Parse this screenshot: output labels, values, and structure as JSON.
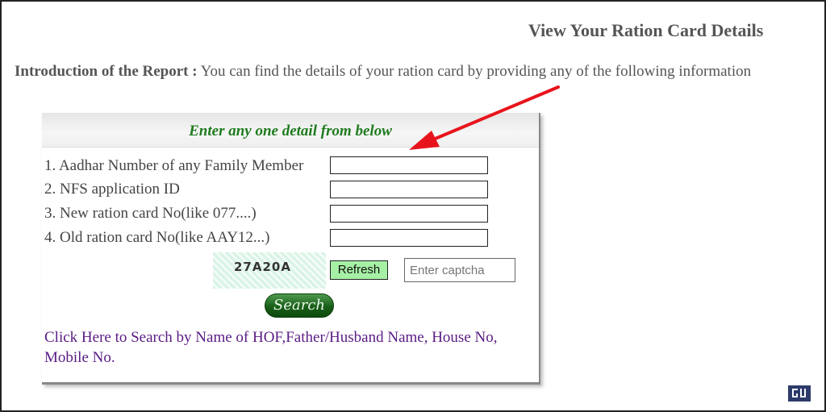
{
  "page_title": "View Your Ration Card Details",
  "intro": {
    "label": "Introduction of the Report :",
    "text": " You can find the details of your ration card by providing any of the following information"
  },
  "panel": {
    "title": "Enter any one detail from below",
    "fields": [
      {
        "label": "1. Aadhar Number of any Family Member",
        "value": ""
      },
      {
        "label": "2. NFS application ID",
        "value": ""
      },
      {
        "label": "3. New ration card No(like 077....)",
        "value": ""
      },
      {
        "label": "4. Old ration card No(like AAY12...)",
        "value": ""
      }
    ],
    "captcha": {
      "code": "27A20A",
      "refresh_label": "Refresh",
      "placeholder": "Enter captcha"
    },
    "search_label": "Search",
    "hof_link": "Click Here to Search by Name of HOF,Father/Husband Name, House No, Mobile No."
  },
  "colors": {
    "title_green": "#1e7b1e",
    "link_purple": "#5a1b84",
    "arrow_red": "#e8141c",
    "refresh_bg": "#a6f0a6"
  }
}
